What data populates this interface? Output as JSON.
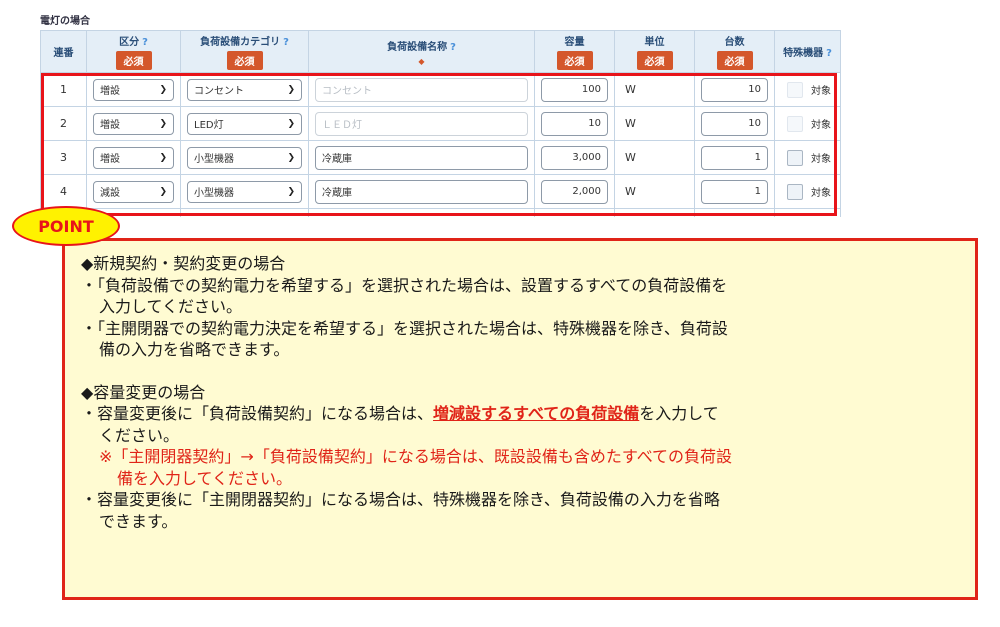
{
  "section": {
    "title": "電灯の場合"
  },
  "columns": {
    "no": "連番",
    "kubun": "区分",
    "category": "負荷設備カテゴリ",
    "name": "負荷設備名称",
    "capacity": "容量",
    "unit": "単位",
    "count": "台数",
    "special": "特殊機器",
    "help": "?",
    "required": "必須",
    "name_marker": "◆"
  },
  "rows": [
    {
      "no": "1",
      "kubun": "増設",
      "category": "コンセント",
      "name": "コンセント",
      "name_disabled": true,
      "capacity": "100",
      "unit": "W",
      "count": "10",
      "special_label": "対象",
      "special_disabled": true
    },
    {
      "no": "2",
      "kubun": "増設",
      "category": "LED灯",
      "name": "ＬＥＤ灯",
      "name_disabled": true,
      "capacity": "10",
      "unit": "W",
      "count": "10",
      "special_label": "対象",
      "special_disabled": true
    },
    {
      "no": "3",
      "kubun": "増設",
      "category": "小型機器",
      "name": "冷蔵庫",
      "name_disabled": false,
      "capacity": "3,000",
      "unit": "W",
      "count": "1",
      "special_label": "対象",
      "special_disabled": false
    },
    {
      "no": "4",
      "kubun": "減設",
      "category": "小型機器",
      "name": "冷蔵庫",
      "name_disabled": false,
      "capacity": "2,000",
      "unit": "W",
      "count": "1",
      "special_label": "対象",
      "special_disabled": false
    }
  ],
  "point": {
    "tag": "POINT",
    "h1": "◆新規契約・契約変更の場合",
    "b1a": "・「負荷設備での契約電力を希望する」を選択された場合は、設置するすべての負荷設備を",
    "b1b": "入力してください。",
    "b2a": "・「主開閉器での契約電力決定を希望する」を選択された場合は、特殊機器を除き、負荷設",
    "b2b": "備の入力を省略できます。",
    "h2": "◆容量変更の場合",
    "b3_pre": "・容量変更後に「負荷設備契約」になる場合は、",
    "b3_emph": "増減設するすべての負荷設備",
    "b3_post": "を入力して",
    "b3b": "ください。",
    "note_a": "※「主開閉器契約」→「負荷設備契約」になる場合は、既設設備も含めたすべての負荷設",
    "note_b": "備を入力してください。",
    "b4a": "・容量変更後に「主開閉器契約」になる場合は、特殊機器を除き、負荷設備の入力を省略",
    "b4b": "できます。"
  }
}
